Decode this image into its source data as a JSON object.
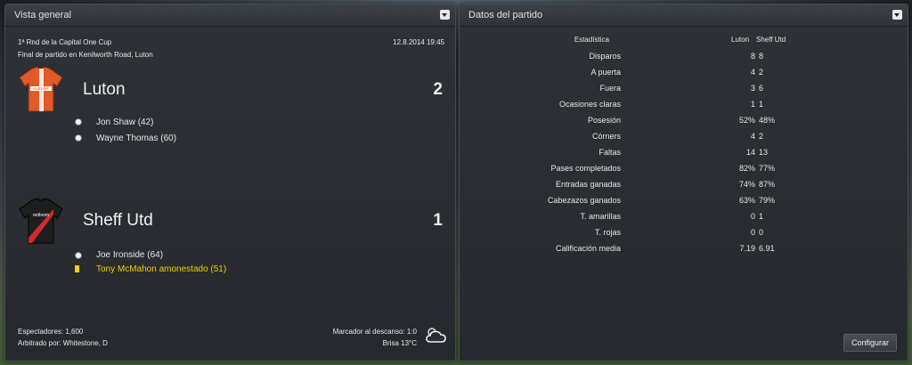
{
  "overview": {
    "title": "Vista general",
    "competition": "1ª Rnd de la Capital One Cup",
    "datetime": "12.8.2014 19:45",
    "venue": "Final de partido en Kenilworth Road, Luton",
    "home": {
      "name": "Luton",
      "score": "2",
      "shirt_sponsor": "easyJet",
      "colors": {
        "primary": "#e05a2a",
        "secondary": "#ffffff"
      },
      "events": [
        {
          "type": "goal",
          "text": "Jon Shaw (42)"
        },
        {
          "type": "goal",
          "text": "Wayne Thomas (60)"
        }
      ]
    },
    "away": {
      "name": "Sheff Utd",
      "score": "1",
      "shirt_sponsor": "redtoom",
      "colors": {
        "primary": "#1a1a1a",
        "secondary": "#d42a2a"
      },
      "events": [
        {
          "type": "goal",
          "text": "Joe Ironside (64)"
        },
        {
          "type": "yellow-card",
          "text": "Tony McMahon amonestado (51)"
        }
      ]
    },
    "attendance": "Espectadores: 1,600",
    "referee": "Arbitrado por: Whitestone, D",
    "halftime": "Marcador al descanso: 1:0",
    "weather": "Brisa 13°C",
    "weather_icon": "cloud-icon"
  },
  "stats": {
    "title": "Datos del partido",
    "header": {
      "label": "Estadística",
      "home": "Luton",
      "away": "Sheff Utd"
    },
    "rows": [
      {
        "label": "Disparos",
        "home": "8",
        "away": "8"
      },
      {
        "label": "A puerta",
        "home": "4",
        "away": "2"
      },
      {
        "label": "Fuera",
        "home": "3",
        "away": "6"
      },
      {
        "label": "Ocasiones claras",
        "home": "1",
        "away": "1"
      },
      {
        "label": "Posesión",
        "home": "52%",
        "away": "48%"
      },
      {
        "label": "Córners",
        "home": "4",
        "away": "2"
      },
      {
        "label": "Faltas",
        "home": "14",
        "away": "13"
      },
      {
        "label": "Pases completados",
        "home": "82%",
        "away": "77%"
      },
      {
        "label": "Entradas ganadas",
        "home": "74%",
        "away": "87%"
      },
      {
        "label": "Cabezazos ganados",
        "home": "63%",
        "away": "79%"
      },
      {
        "label": "T. amarillas",
        "home": "0",
        "away": "1"
      },
      {
        "label": "T. rojas",
        "home": "0",
        "away": "0"
      },
      {
        "label": "Calificación media",
        "home": "7.19",
        "away": "6.91"
      }
    ],
    "configure_label": "Configurar"
  }
}
